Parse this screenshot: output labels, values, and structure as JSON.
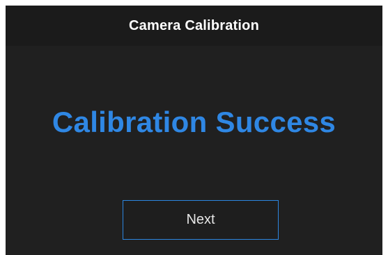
{
  "dialog": {
    "title": "Camera Calibration",
    "message": "Calibration Success",
    "next_label": "Next"
  },
  "colors": {
    "accent": "#2f87e4",
    "background": "#202020",
    "titlebar": "#1b1b1b",
    "text": "#ffffff"
  }
}
